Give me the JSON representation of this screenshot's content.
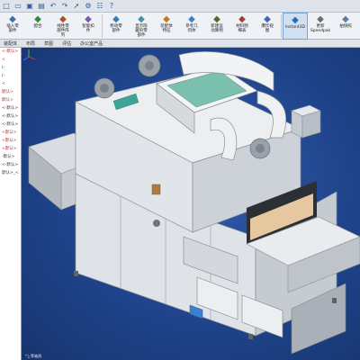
{
  "quickbar": {
    "icons": [
      "new-file-icon",
      "open-icon",
      "save-icon",
      "print-icon",
      "undo-icon",
      "redo-icon",
      "select-icon",
      "rebuild-icon",
      "options-icon",
      "help-icon"
    ]
  },
  "ribbon": {
    "buttons": [
      {
        "name": "insert-component-button",
        "icon": "insert-component-icon",
        "label": "插入零\n部件",
        "color": "#3b6fb5"
      },
      {
        "name": "mate-button",
        "icon": "mate-icon",
        "label": "配合",
        "color": "#2f8a3a"
      },
      {
        "name": "linear-pattern-button",
        "icon": "linear-pattern-icon",
        "label": "线性零\n部件阵\n列",
        "color": "#b34a2a"
      },
      {
        "name": "smart-fasteners-button",
        "icon": "smart-fasteners-icon",
        "label": "智能扣\n件",
        "color": "#7a5aa8"
      },
      {
        "name": "move-component-button",
        "icon": "move-component-icon",
        "label": "移动零\n部件",
        "color": "#2f7cc1"
      },
      {
        "name": "show-hidden-button",
        "icon": "show-hidden-icon",
        "label": "显示隐\n藏的零\n部件",
        "color": "#4a8f9e"
      },
      {
        "name": "assembly-features-button",
        "icon": "assembly-features-icon",
        "label": "装配体\n特征",
        "color": "#c27b1f"
      },
      {
        "name": "reference-geometry-button",
        "icon": "reference-geometry-icon",
        "label": "参考几\n何体",
        "color": "#3b82c4"
      },
      {
        "name": "new-motion-study-button",
        "icon": "new-motion-study-icon",
        "label": "新建运\n动算例",
        "color": "#4b6f2a"
      },
      {
        "name": "bill-of-materials-button",
        "icon": "bill-of-materials-icon",
        "label": "材料明\n细表",
        "color": "#a33b3b"
      },
      {
        "name": "exploded-view-button",
        "icon": "exploded-view-icon",
        "label": "爆炸视\n图",
        "color": "#3f66b0"
      },
      {
        "name": "instant3d-button",
        "icon": "instant3d-icon",
        "label": "Instant3D",
        "color": "#2b6db5"
      },
      {
        "name": "update-speedpak-button",
        "icon": "update-speedpak-icon",
        "label": "更新\nSpeedpak",
        "color": "#6d6d6d"
      },
      {
        "name": "take-snapshot-button",
        "icon": "take-snapshot-icon",
        "label": "拍快照",
        "color": "#5a7fa8"
      }
    ]
  },
  "tabs": [
    "装配体",
    "布局",
    "草图",
    "评估",
    "办公室产品"
  ],
  "tree": {
    "items": [
      {
        "text": "<-默认>",
        "color": "#c0272d"
      },
      {
        "text": "<",
        "color": "#c0272d"
      },
      {
        "text": "(-",
        "color": "#333333"
      },
      {
        "text": "(-",
        "color": "#333333"
      },
      {
        "text": "<",
        "color": "#c0272d"
      },
      {
        "text": "默认>",
        "color": "#c0272d"
      },
      {
        "text": "默认>",
        "color": "#c0272d"
      },
      {
        "text": "<-默认>",
        "color": "#333333"
      },
      {
        "text": "<-默认>",
        "color": "#333333"
      },
      {
        "text": "<-默认>",
        "color": "#333333"
      },
      {
        "text": "<默认>",
        "color": "#c0272d"
      },
      {
        "text": "<默认>",
        "color": "#c0272d"
      },
      {
        "text": "<默认>",
        "color": "#c0272d"
      },
      {
        "text": "-默认>",
        "color": "#333333"
      },
      {
        "text": "<-默认>",
        "color": "#333333"
      },
      {
        "text": "默认>_<",
        "color": "#333333"
      }
    ]
  },
  "viewport": {
    "model": "uv-curing-machine",
    "panel_screen_color": "#3a7fd0",
    "triad_label": "*上等轴测"
  },
  "colors": {
    "viewport_bg": "#1f3f7c",
    "machine_body": "#e7e9ec",
    "machine_shadow": "#b9bec5",
    "duct": "#f0f1f2",
    "window_glass": "#6fb7a6"
  }
}
